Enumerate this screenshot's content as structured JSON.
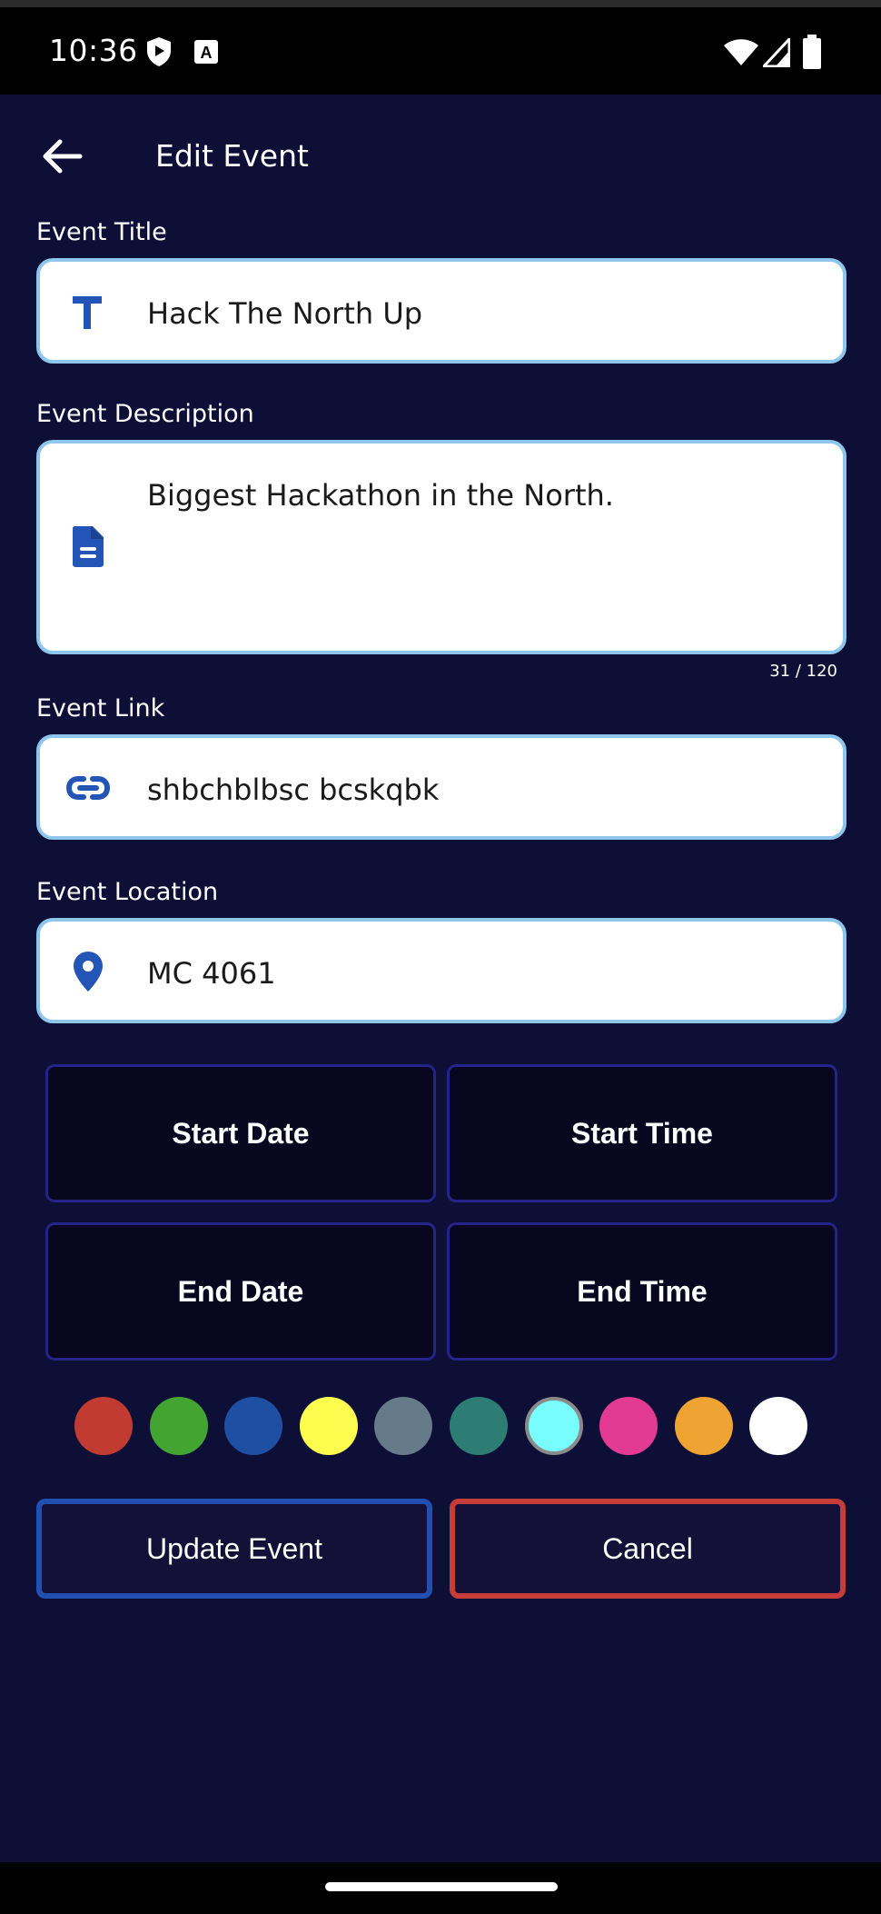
{
  "status_bar": {
    "time": "10:36",
    "left_icons": [
      "shield-icon",
      "font-icon"
    ],
    "right_icons": [
      "wifi-icon",
      "signal-icon",
      "battery-icon"
    ]
  },
  "app_bar": {
    "title": "Edit Event",
    "back_icon": "arrow-back-icon"
  },
  "form": {
    "title": {
      "label": "Event Title",
      "value": "Hack The North Up",
      "icon": "title-icon"
    },
    "description": {
      "label": "Event Description",
      "value": "Biggest Hackathon in the North.",
      "icon": "document-icon",
      "counter": "31 / 120"
    },
    "link": {
      "label": "Event Link",
      "value": "shbchblbsc bcskqbk",
      "icon": "link-icon"
    },
    "location": {
      "label": "Event Location",
      "value": "MC 4061",
      "icon": "location-pin-icon"
    }
  },
  "date_time": {
    "start_date": "Start Date",
    "start_time": "Start Time",
    "end_date": "End Date",
    "end_time": "End Time"
  },
  "color_picker": {
    "colors": [
      "#c23b33",
      "#43a432",
      "#1f4fa3",
      "#fcfd4f",
      "#667b8a",
      "#2d7d74",
      "#79fcfc",
      "#e33b93",
      "#eea332",
      "#ffffff"
    ],
    "selected": "#79fcfc"
  },
  "actions": {
    "update_label": "Update Event",
    "cancel_label": "Cancel",
    "update_color": "#2150b0",
    "cancel_color": "#c63c39"
  },
  "theme": {
    "background": "#0e0f36",
    "field_border": "#8ec5ea",
    "icon_color": "#2255b5"
  }
}
